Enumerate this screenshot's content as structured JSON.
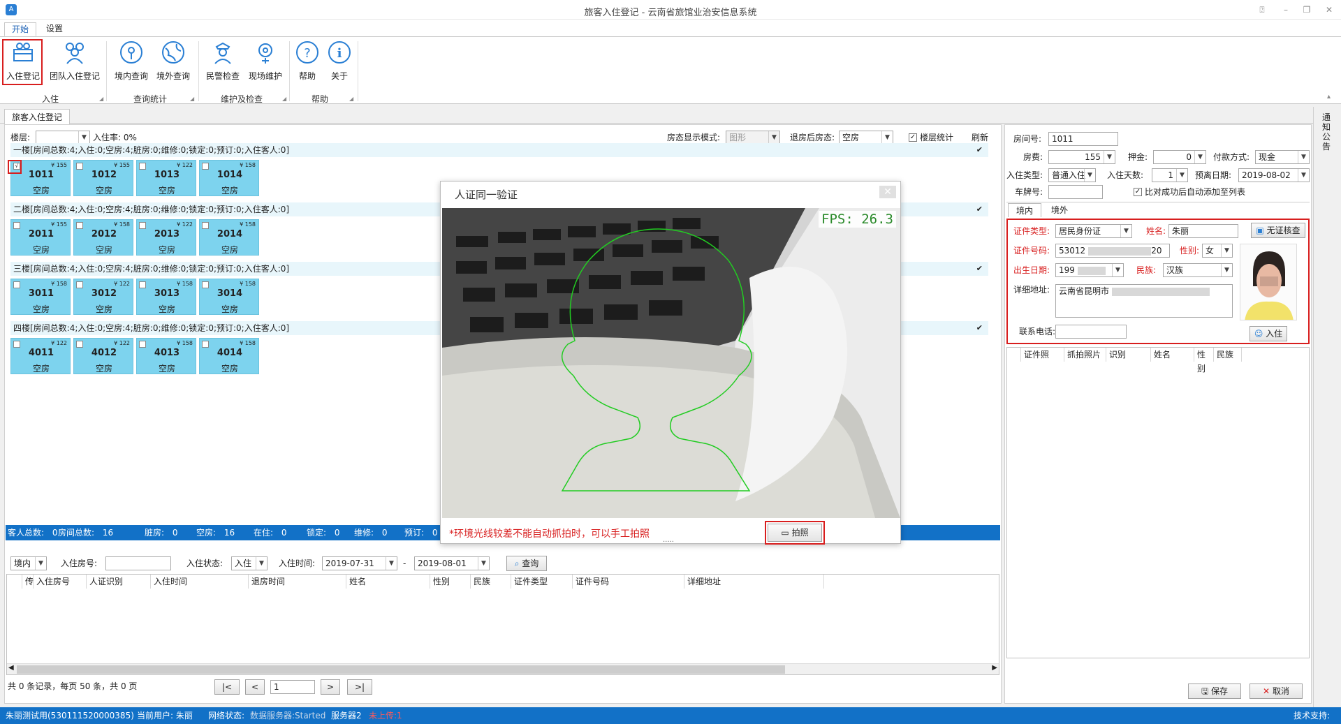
{
  "window": {
    "title": "旅客入住登记 - 云南省旅馆业治安信息系统"
  },
  "ribbon": {
    "tabs": [
      "开始",
      "设置"
    ],
    "buttons": [
      "入住登记",
      "团队入住登记",
      "境内查询",
      "境外查询",
      "民警检查",
      "现场维护",
      "帮助",
      "关于"
    ],
    "groups": [
      "入住",
      "查询统计",
      "维护及检查",
      "帮助"
    ]
  },
  "doc_tab": "旅客入住登记",
  "side_notice": "通知公告",
  "toolbar": {
    "floor_label": "楼层:",
    "occupancy": "入住率: 0%",
    "display_mode_label": "房态显示模式:",
    "display_mode_value": "图形",
    "after_checkout_label": "退房后房态:",
    "after_checkout_value": "空房",
    "floor_stats": "楼层统计",
    "refresh": "刷新"
  },
  "floors": [
    {
      "header": "一楼[房间总数:4;入住:0;空房:4;脏房:0;维修:0;锁定:0;预订:0;入住客人:0]",
      "rooms": [
        {
          "num": "1011",
          "price": "¥ 155",
          "status": "空房",
          "checked": "√"
        },
        {
          "num": "1012",
          "price": "¥ 155",
          "status": "空房",
          "checked": ""
        },
        {
          "num": "1013",
          "price": "¥ 122",
          "status": "空房",
          "checked": ""
        },
        {
          "num": "1014",
          "price": "¥ 158",
          "status": "空房",
          "checked": ""
        }
      ]
    },
    {
      "header": "二楼[房间总数:4;入住:0;空房:4;脏房:0;维修:0;锁定:0;预订:0;入住客人:0]",
      "rooms": [
        {
          "num": "2011",
          "price": "¥ 155",
          "status": "空房",
          "checked": ""
        },
        {
          "num": "2012",
          "price": "¥ 158",
          "status": "空房",
          "checked": ""
        },
        {
          "num": "2013",
          "price": "¥ 122",
          "status": "空房",
          "checked": ""
        },
        {
          "num": "2014",
          "price": "¥ 158",
          "status": "空房",
          "checked": ""
        }
      ]
    },
    {
      "header": "三楼[房间总数:4;入住:0;空房:4;脏房:0;维修:0;锁定:0;预订:0;入住客人:0]",
      "rooms": [
        {
          "num": "3011",
          "price": "¥ 158",
          "status": "空房",
          "checked": ""
        },
        {
          "num": "3012",
          "price": "¥ 122",
          "status": "空房",
          "checked": ""
        },
        {
          "num": "3013",
          "price": "¥ 158",
          "status": "空房",
          "checked": ""
        },
        {
          "num": "3014",
          "price": "¥ 158",
          "status": "空房",
          "checked": ""
        }
      ]
    },
    {
      "header": "四楼[房间总数:4;入住:0;空房:4;脏房:0;维修:0;锁定:0;预订:0;入住客人:0]",
      "rooms": [
        {
          "num": "4011",
          "price": "¥ 122",
          "status": "空房",
          "checked": ""
        },
        {
          "num": "4012",
          "price": "¥ 122",
          "status": "空房",
          "checked": ""
        },
        {
          "num": "4013",
          "price": "¥ 158",
          "status": "空房",
          "checked": ""
        },
        {
          "num": "4014",
          "price": "¥ 158",
          "status": "空房",
          "checked": ""
        }
      ]
    }
  ],
  "stats": [
    {
      "label": "客人总数:",
      "value": "0"
    },
    {
      "label": "房间总数:",
      "value": "16"
    },
    {
      "label": "脏房:",
      "value": "0"
    },
    {
      "label": "空房:",
      "value": "16"
    },
    {
      "label": "在住:",
      "value": "0"
    },
    {
      "label": "锁定:",
      "value": "0"
    },
    {
      "label": "维修:",
      "value": "0"
    },
    {
      "label": "预订:",
      "value": "0"
    }
  ],
  "query": {
    "scope": "境内",
    "room_label": "入住房号:",
    "status_label": "入住状态:",
    "status_value": "入住",
    "time_label": "入住时间:",
    "date_from": "2019-07-31",
    "date_to": "2019-08-01",
    "search": "查询"
  },
  "result_columns": [
    "",
    "传",
    "入住房号",
    "人证识别",
    "入住时间",
    "退房时间",
    "姓名",
    "性别",
    "民族",
    "证件类型",
    "证件号码",
    "详细地址"
  ],
  "pager": {
    "summary": "共 0 条记录，每页 50 条，共 0 页",
    "first": "|<",
    "prev": "<",
    "page": "1",
    "next": ">",
    "last": ">|"
  },
  "modal": {
    "title": "人证同一验证",
    "fps": "FPS: 26.3",
    "hint": "*环境光线较差不能自动抓拍时，可以手工拍照",
    "capture": "拍照",
    "dots": "....."
  },
  "checkin": {
    "room_label": "房间号:",
    "room_value": "1011",
    "fee_label": "房费:",
    "fee_value": "155",
    "deposit_label": "押金:",
    "deposit_value": "0",
    "pay_label": "付款方式:",
    "pay_value": "现金",
    "type_label": "入住类型:",
    "type_value": "普通入住",
    "days_label": "入住天数:",
    "days_value": "1",
    "leave_label": "预离日期:",
    "leave_value": "2019-08-02",
    "plate_label": "车牌号:",
    "auto_add": "比对成功后自动添加至列表",
    "tabs": [
      "境内",
      "境外"
    ]
  },
  "id": {
    "type_label": "证件类型:",
    "type_value": "居民身份证",
    "name_label": "姓名:",
    "name_value": "朱丽",
    "no_id_btn": "无证核查",
    "idno_label": "证件号码:",
    "idno_value": "53012",
    "idno_tail": "20",
    "sex_label": "性别:",
    "sex_value": "女",
    "birth_label": "出生日期:",
    "birth_value": "199",
    "nation_label": "民族:",
    "nation_value": "汉族",
    "addr_label": "详细地址:",
    "addr_value": "云南省昆明市",
    "phone_label": "联系电话:",
    "checkin_btn": "入住"
  },
  "guest_columns": [
    "",
    "证件照",
    "抓拍照片",
    "识别",
    "姓名",
    "性别",
    "民族"
  ],
  "actions": {
    "save": "保存",
    "cancel": "取消"
  },
  "status": {
    "user_info": "朱丽测试用(530111520000385)",
    "current_user": "当前用户: 朱丽",
    "network": "网络状态:",
    "data_server": "数据服务器:Started",
    "server2": "服务器2",
    "unuploaded": "未上传:1",
    "support": "技术支持:"
  },
  "colors": {
    "accent": "#1271c7",
    "room": "#7dd3ee",
    "highlight": "#d81e1e",
    "face_outline": "#22cc22"
  }
}
